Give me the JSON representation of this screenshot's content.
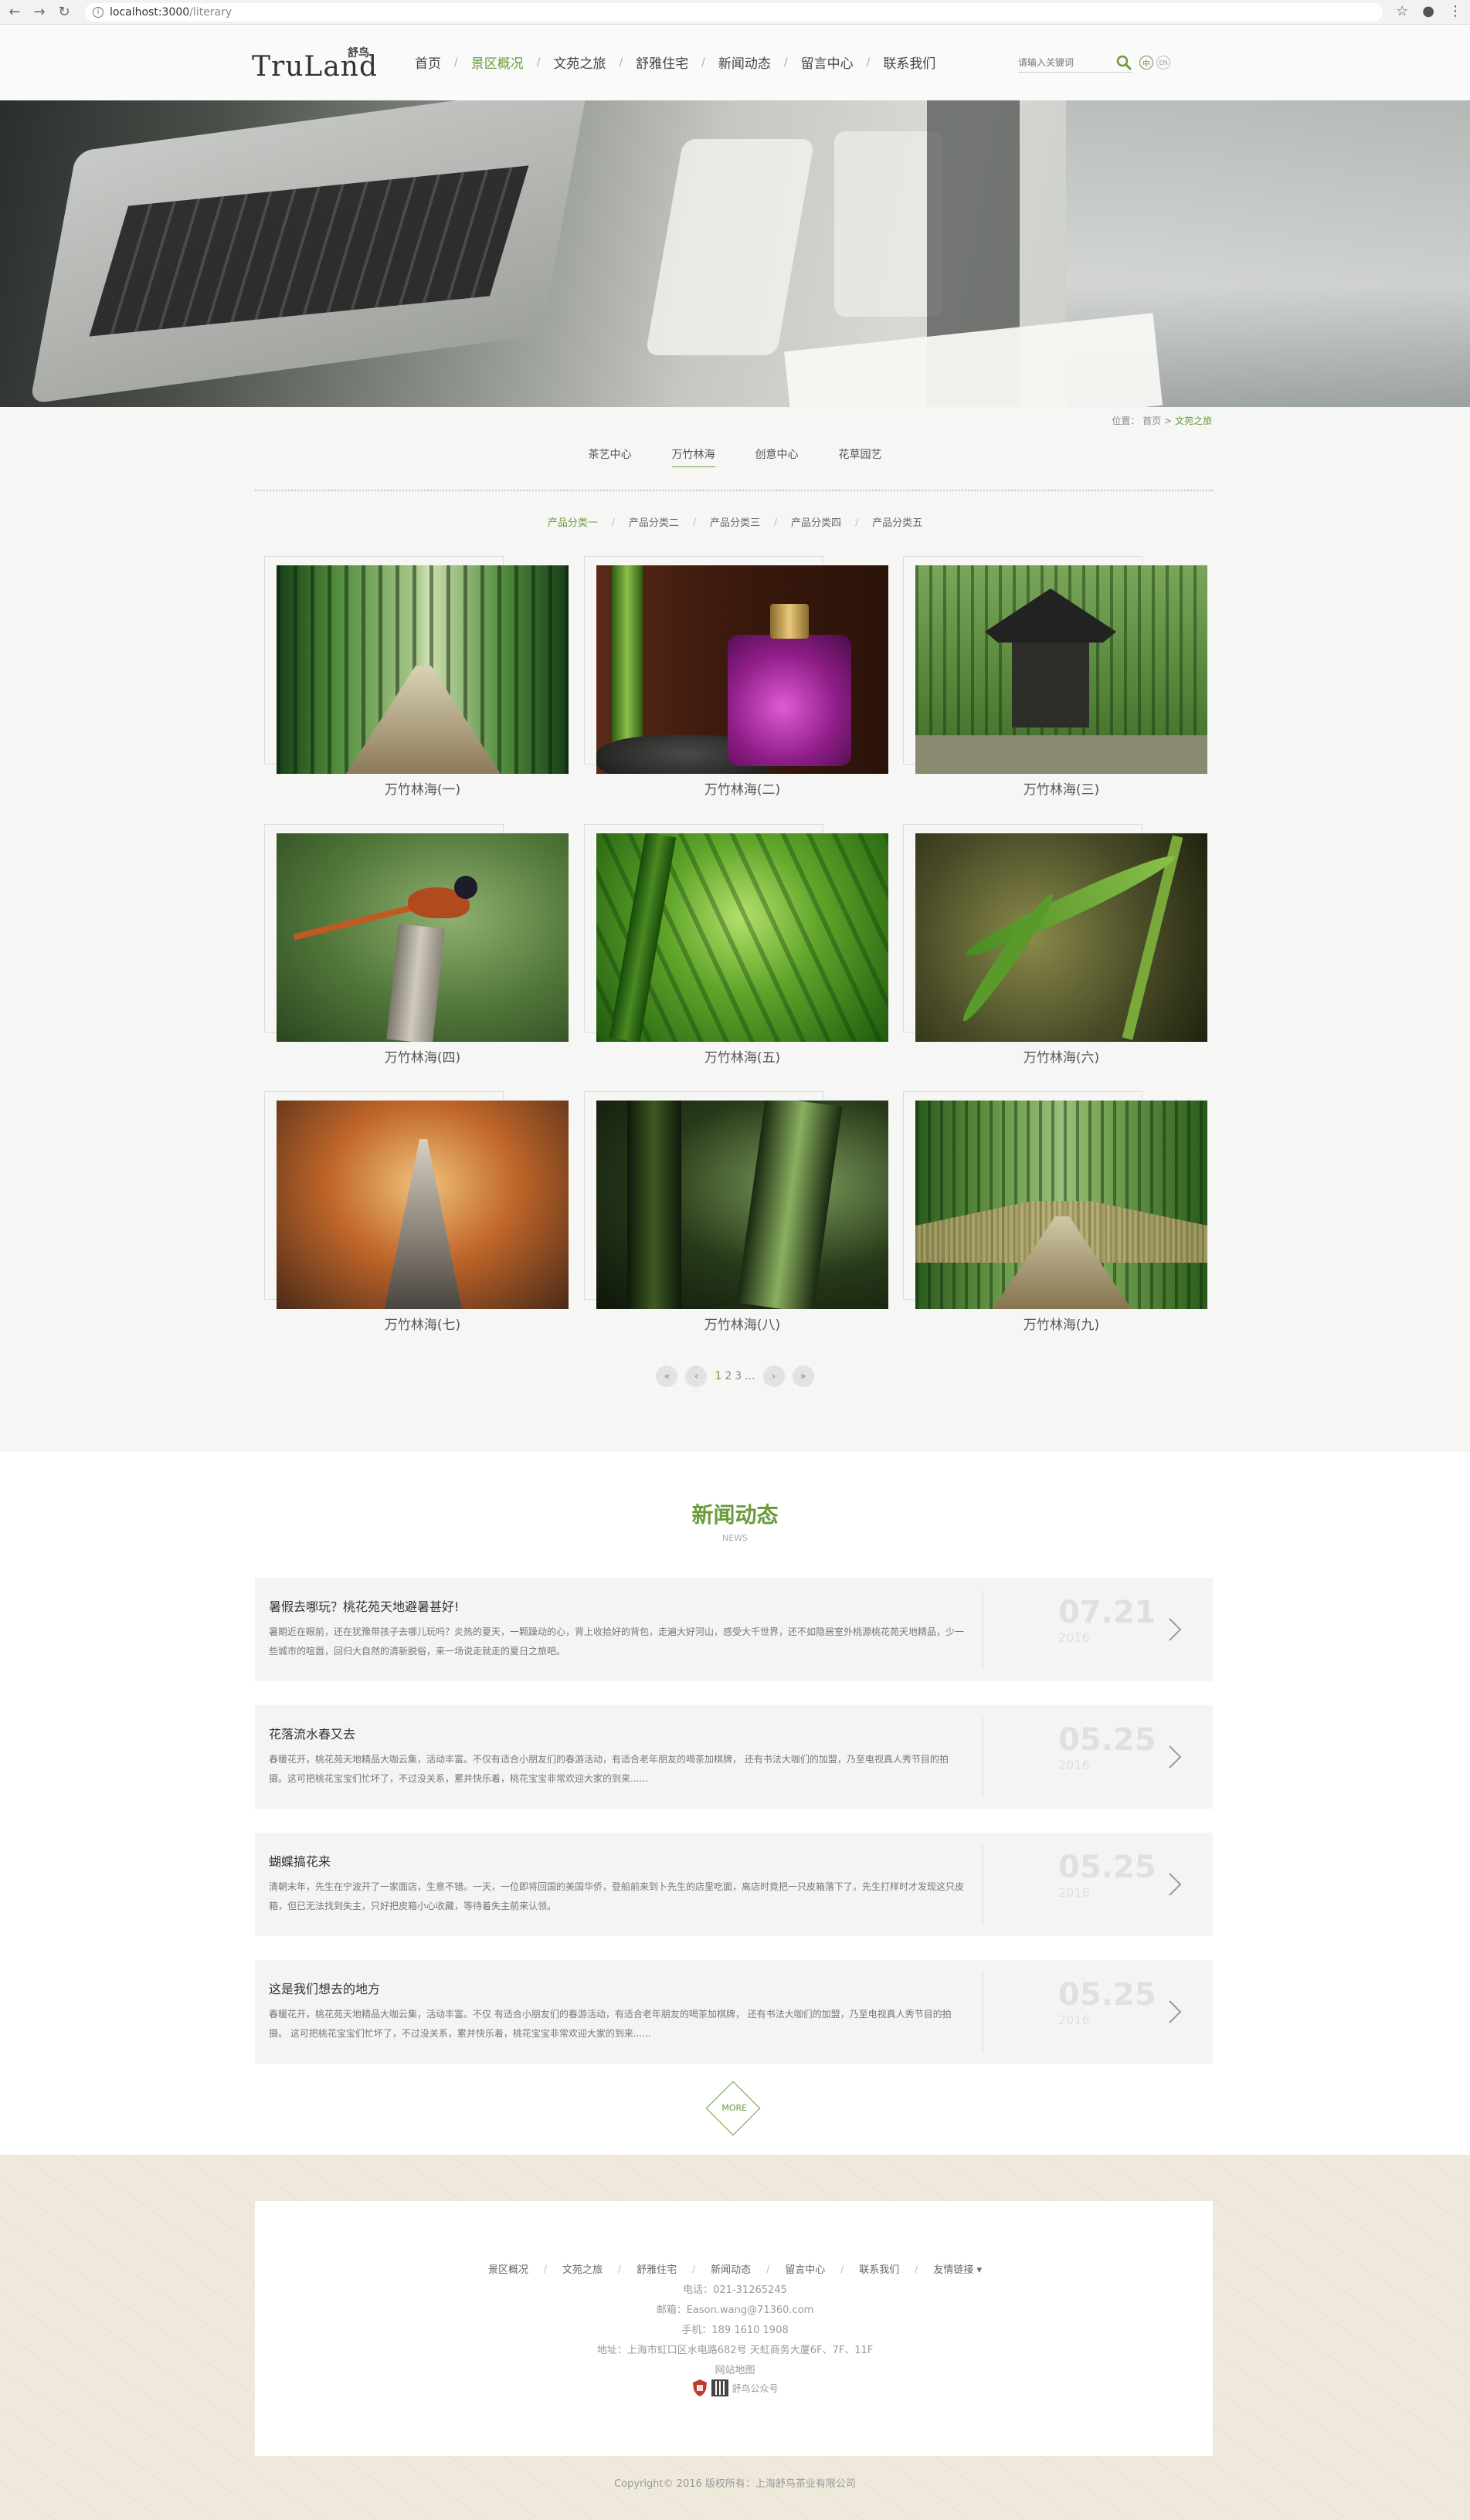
{
  "browser": {
    "url_host": "localhost:3000",
    "url_path": "/literary"
  },
  "header": {
    "logo_text": "TruLand",
    "logo_cn": "舒鸟",
    "nav": [
      "首页",
      "景区概况",
      "文苑之旅",
      "舒雅住宅",
      "新闻动态",
      "留言中心",
      "联系我们"
    ],
    "active_nav": "景区概况",
    "search_placeholder": "请输入关键词",
    "lang_cn": "中",
    "lang_en": "EN"
  },
  "breadcrumb": {
    "prefix": "位置：",
    "home": "首页",
    "separator": ">",
    "current": "文苑之旅"
  },
  "subtabs": [
    "茶艺中心",
    "万竹林海",
    "创意中心",
    "花草园艺"
  ],
  "active_subtab": "万竹林海",
  "categories": [
    "产品分类一",
    "产品分类二",
    "产品分类三",
    "产品分类四",
    "产品分类五"
  ],
  "active_category": "产品分类一",
  "gallery": [
    {
      "caption": "万竹林海(一)"
    },
    {
      "caption": "万竹林海(二)"
    },
    {
      "caption": "万竹林海(三)"
    },
    {
      "caption": "万竹林海(四)"
    },
    {
      "caption": "万竹林海(五)"
    },
    {
      "caption": "万竹林海(六)"
    },
    {
      "caption": "万竹林海(七)"
    },
    {
      "caption": "万竹林海(八)"
    },
    {
      "caption": "万竹林海(九)"
    }
  ],
  "pager": {
    "first": "«",
    "prev": "‹",
    "pages": [
      "1",
      "2",
      "3",
      "..."
    ],
    "next": "›",
    "last": "»",
    "current_page": "1"
  },
  "news": {
    "title": "新闻动态",
    "subtitle": "NEWS",
    "more": "MORE",
    "items": [
      {
        "title": "暑假去哪玩？桃花苑天地避暑甚好!",
        "body": "暑期近在眼前，还在犹豫带孩子去哪儿玩吗？炎热的夏天，一颗躁动的心，背上收拾好的背包，走遍大好河山，感受大千世界，还不如隐居室外桃源桃花苑天地精品，少一些城市的喧嚣，回归大自然的清新脱俗，来一场说走就走的夏日之旅吧。",
        "date": "07.21",
        "year": "2016"
      },
      {
        "title": "花落流水春又去",
        "body": "春暖花开，桃花苑天地精品大咖云集，活动丰富。不仅有适合小朋友们的春游活动，有适合老年朋友的喝茶加棋牌， 还有书法大咖们的加盟，乃至电视真人秀节目的拍摄。这可把桃花宝宝们忙坏了，不过没关系，累并快乐着，桃花宝宝非常欢迎大家的到来......",
        "date": "05.25",
        "year": "2016"
      },
      {
        "title": "蝴蝶搞花来",
        "body": "清朝末年，先生在宁波开了一家面店，生意不错。一天，一位即将回国的美国华侨，登船前来到卜先生的店里吃面，离店时竟把一只皮箱落下了。先生打样时才发现这只皮箱，但已无法找到失主，只好把皮箱小心收藏，等待着失主前来认领。",
        "date": "05.25",
        "year": "2016"
      },
      {
        "title": "这是我们想去的地方",
        "body": "春暖花开，桃花苑天地精品大咖云集，活动丰富。不仅 有适合小朋友们的春游活动，有适合老年朋友的喝茶加棋牌， 还有书法大咖们的加盟，乃至电视真人秀节目的拍摄。 这可把桃花宝宝们忙坏了，不过没关系，累并快乐着，桃花宝宝非常欢迎大家的到来......",
        "date": "05.25",
        "year": "2016"
      }
    ]
  },
  "footer": {
    "nav": [
      "景区概况",
      "文苑之旅",
      "舒雅住宅",
      "新闻动态",
      "留言中心",
      "联系我们",
      "友情链接"
    ],
    "phone": "电话：021-31265245",
    "email": "邮箱：Eason.wang@71360.com",
    "mobile": "手机：189 1610 1908",
    "address": "地址：上海市虹口区水电路682号 天虹商务大厦6F、7F、11F",
    "sitemap": "网站地图",
    "wechat": "舒鸟公众号",
    "copyright": "Copyright© 2016 版权所有：上海舒鸟茶业有限公司"
  }
}
